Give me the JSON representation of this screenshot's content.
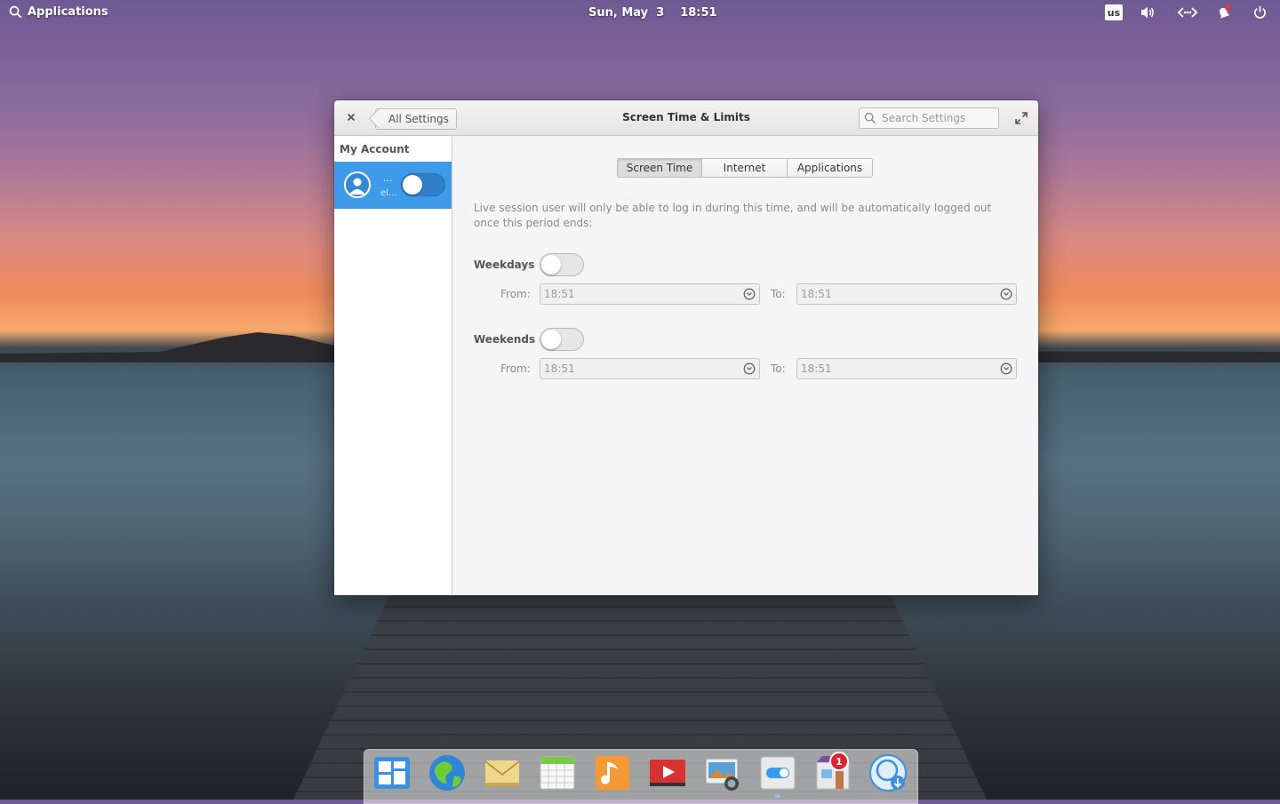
{
  "top_panel": {
    "applications_label": "Applications",
    "date": "Sun, May  3",
    "time": "18:51",
    "keyboard_layout": "us",
    "indicators": [
      "volume-icon",
      "network-icon",
      "notifications-icon",
      "power-icon"
    ],
    "notification_color": "#e23b3b"
  },
  "window": {
    "title": "Screen Time & Limits",
    "back_label": "All Settings",
    "search_placeholder": "Search Settings"
  },
  "sidebar": {
    "header": "My Account",
    "user": {
      "name": "...",
      "subtitle": "el...",
      "enabled": false
    },
    "accent_color": "#3d9be9"
  },
  "tabs": [
    {
      "label": "Screen Time",
      "active": true
    },
    {
      "label": "Internet",
      "active": false
    },
    {
      "label": "Applications",
      "active": false
    }
  ],
  "description": "Live session user will only be able to log in during this time, and will be automatically logged out once this period ends:",
  "schedules": {
    "weekdays": {
      "label": "Weekdays",
      "enabled": false,
      "from_label": "From:",
      "from": "18:51",
      "to_label": "To:",
      "to": "18:51"
    },
    "weekends": {
      "label": "Weekends",
      "enabled": false,
      "from_label": "From:",
      "from": "18:51",
      "to_label": "To:",
      "to": "18:51"
    }
  },
  "dock": {
    "apps": [
      "multitasking-view-icon",
      "web-browser-icon",
      "mail-icon",
      "calendar-icon",
      "music-icon",
      "videos-icon",
      "photos-icon",
      "system-settings-icon",
      "appcenter-icon",
      "software-update-icon"
    ],
    "appcenter_badge": "1"
  }
}
